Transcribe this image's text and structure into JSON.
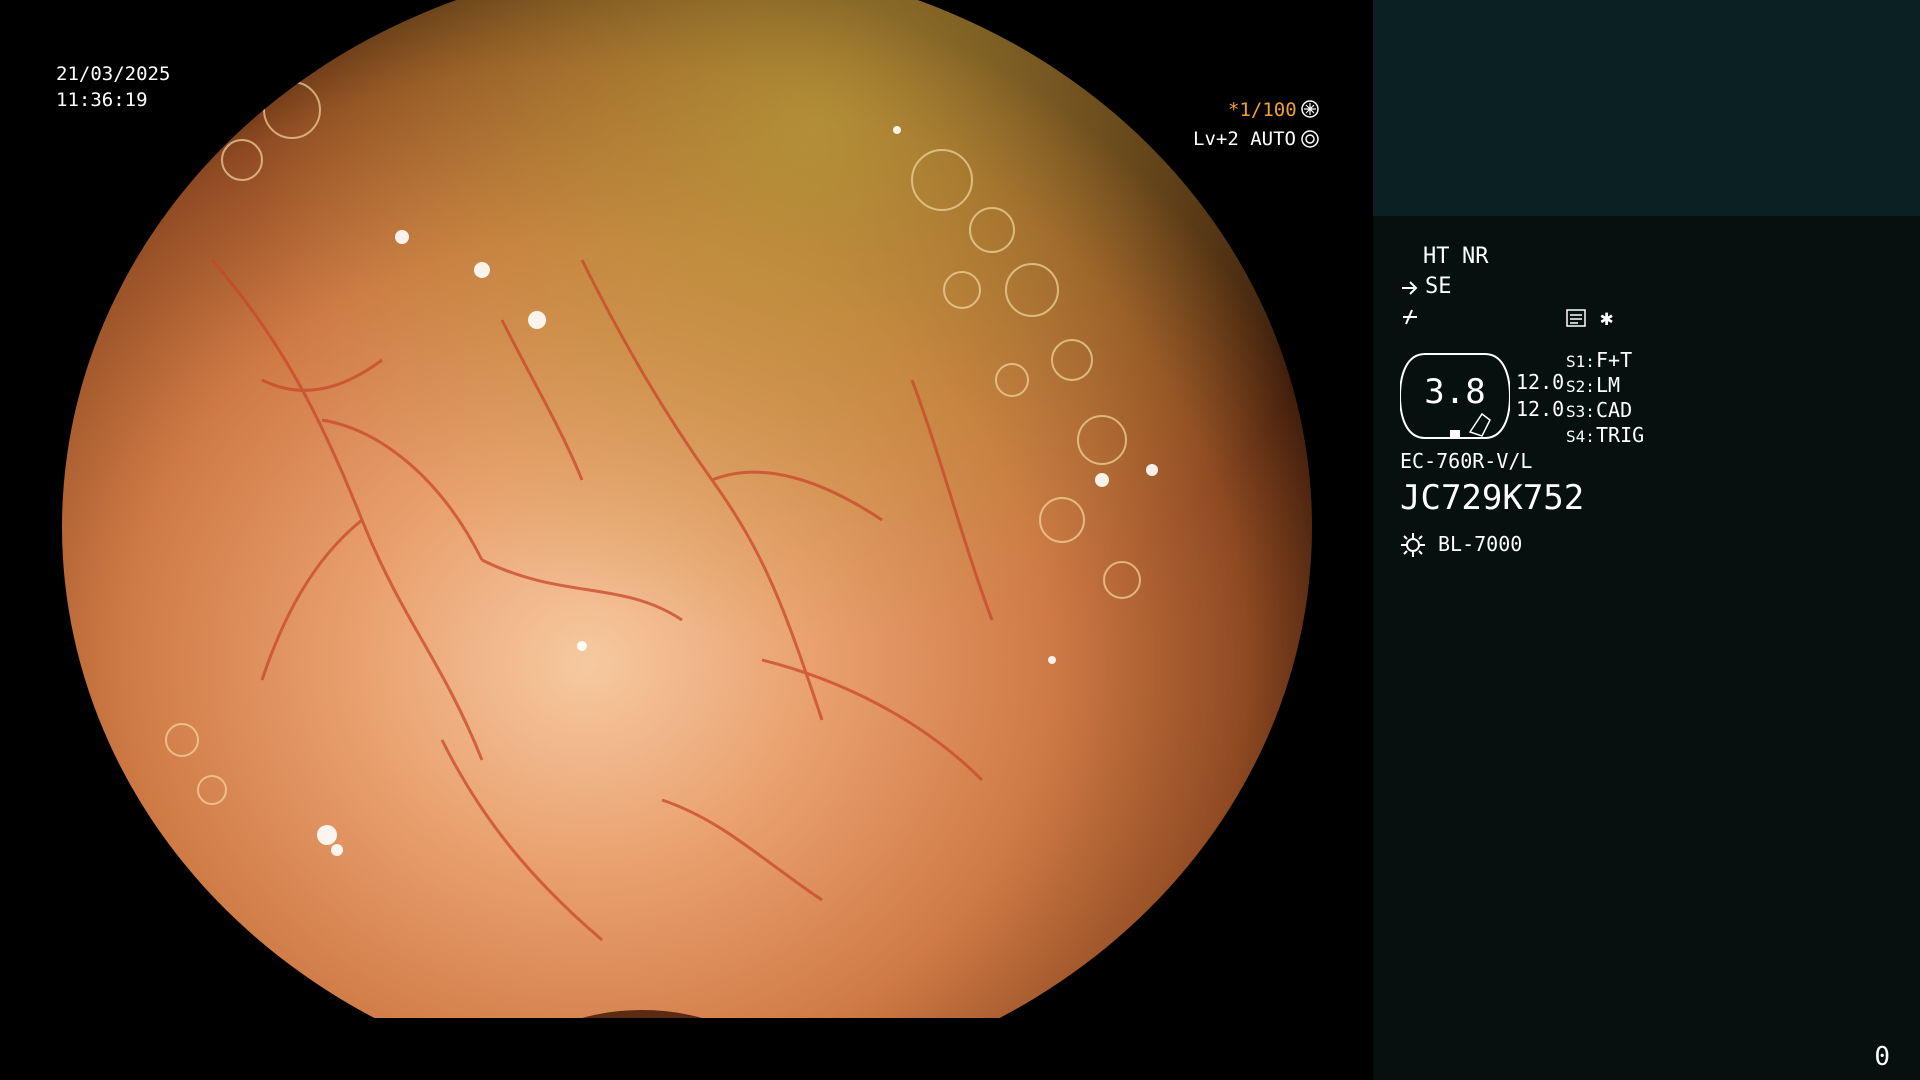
{
  "overlay": {
    "date": "21/03/2025",
    "time": "11:36:19",
    "shutter": "*1/100",
    "level": "Lv+2 AUTO"
  },
  "panel": {
    "ht": "HT",
    "nr": "NR",
    "se": "SE",
    "badge_value": "3.8",
    "value_a": "12.0",
    "value_b": "12.0",
    "s1_key": "S1:",
    "s1_val": "F+T",
    "s2_key": "S2:",
    "s2_val": "LM",
    "s3_key": "S3:",
    "s3_val": "CAD",
    "s4_key": "S4:",
    "s4_val": "TRIG",
    "model": "EC-760R-V/L",
    "serial": "JC729K752",
    "light": "BL-7000",
    "counter": "0"
  },
  "colors": {
    "accent": "#f0a030",
    "panel_bg": "#06100f",
    "panel_top_bg": "#0b2022"
  },
  "icons": [
    "shutter-mode-icon",
    "auto-iris-icon",
    "scope-tip-icon",
    "bend-icon",
    "memo-icon",
    "asterisk-icon",
    "light-source-icon"
  ]
}
